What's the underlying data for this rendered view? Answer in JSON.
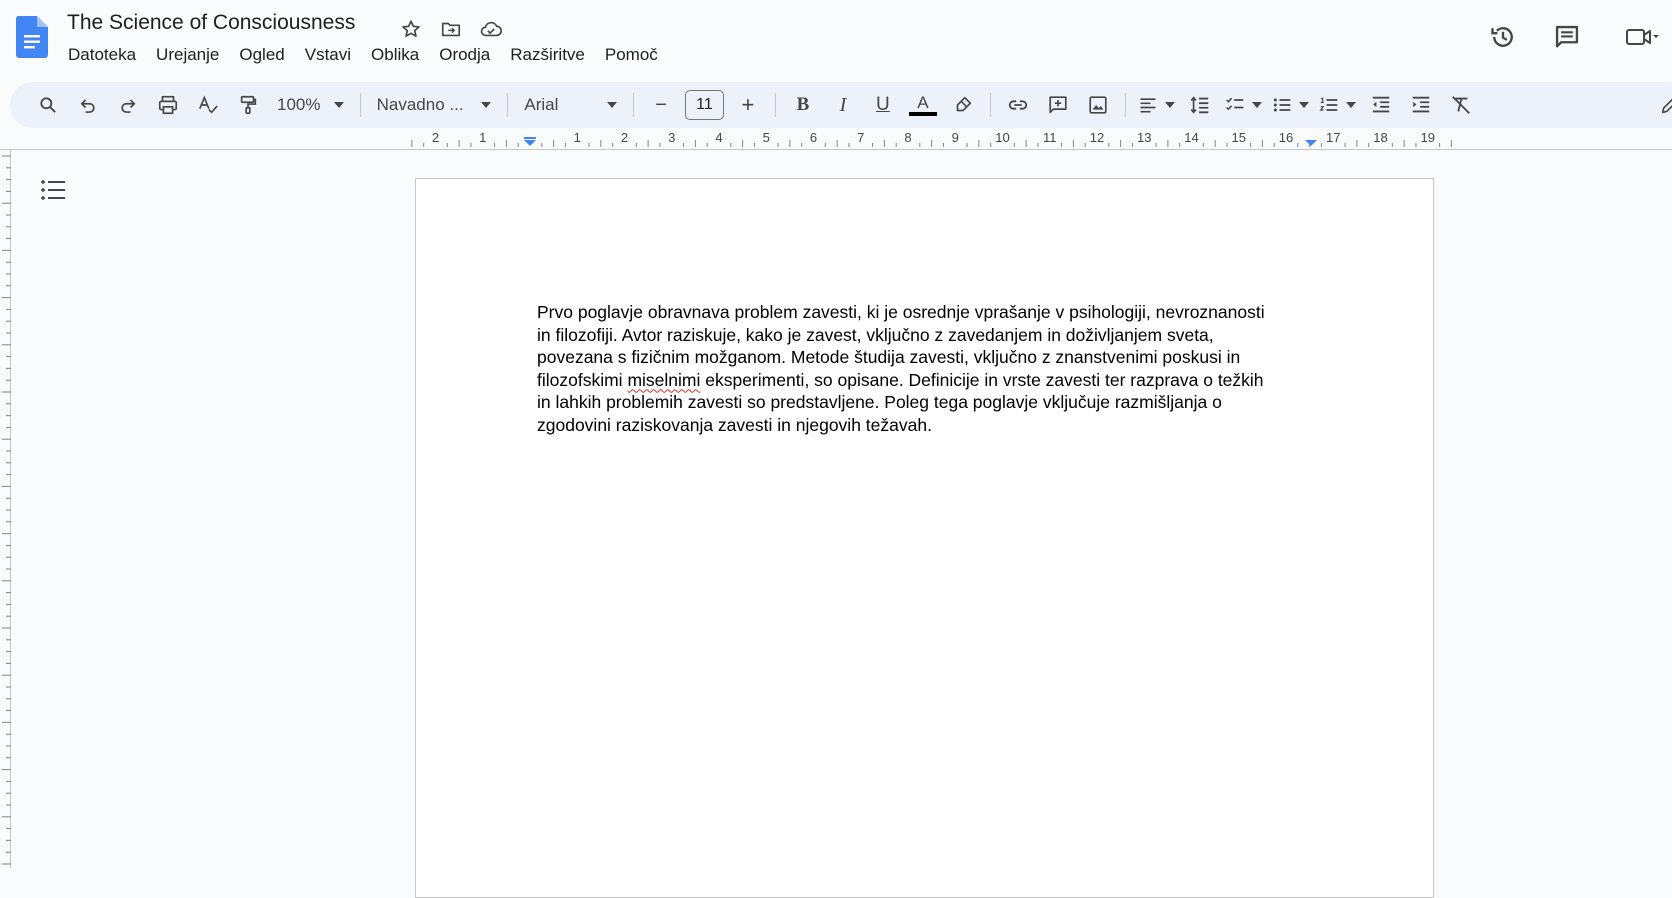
{
  "document": {
    "title": "The Science of Consciousness"
  },
  "menu": [
    "Datoteka",
    "Urejanje",
    "Ogled",
    "Vstavi",
    "Oblika",
    "Orodja",
    "Razširitve",
    "Pomoč"
  ],
  "toolbar": {
    "zoom": "100%",
    "style": "Navadno ...",
    "font": "Arial",
    "font_size": "11",
    "bold": "B",
    "italic": "I",
    "underline": "U",
    "text_color_letter": "A",
    "minus": "−",
    "plus": "+"
  },
  "ruler": {
    "labels": [
      "2",
      "1",
      "1",
      "2",
      "3",
      "4",
      "5",
      "6",
      "7",
      "8",
      "9",
      "10",
      "11",
      "12",
      "13",
      "14",
      "15",
      "16",
      "17",
      "18",
      "19"
    ]
  },
  "body": {
    "line1": "Prvo poglavje obravnava problem zavesti, ki je osrednje vprašanje v psihologiji, nevroznanosti",
    "line2": "in filozofiji. Avtor raziskuje, kako je zavest, vključno z zavedanjem in doživljanjem sveta,",
    "line3": "povezana s fizičnim možganom. Metode študija zavesti, vključno z znanstvenimi poskusi in",
    "line4_pre": "filozofskimi ",
    "line4_misspelled": "miselnimi",
    "line4_post": " eksperimenti, so opisane. Definicije in vrste zavesti ter razprava o težkih",
    "line5": "in lahkih problemih zavesti so predstavljene. Poleg tega poglavje vključuje razmišljanja o",
    "line6": "zgodovini raziskovanja zavesti in njegovih težavah."
  },
  "colors": {
    "docs_blue": "#4285f4",
    "text_color": "#000000",
    "spell_underline": "#d93025"
  },
  "icons": [
    "docs-logo-icon",
    "star-icon",
    "move-folder-icon",
    "cloud-saved-icon",
    "history-icon",
    "comments-icon",
    "meet-icon",
    "search-icon",
    "undo-icon",
    "redo-icon",
    "print-icon",
    "spellcheck-icon",
    "paint-format-icon",
    "highlight-icon",
    "link-icon",
    "add-comment-icon",
    "insert-image-icon",
    "align-icon",
    "line-spacing-icon",
    "checklist-icon",
    "bulleted-list-icon",
    "numbered-list-icon",
    "decrease-indent-icon",
    "increase-indent-icon",
    "clear-formatting-icon",
    "editing-mode-icon",
    "outline-icon"
  ]
}
